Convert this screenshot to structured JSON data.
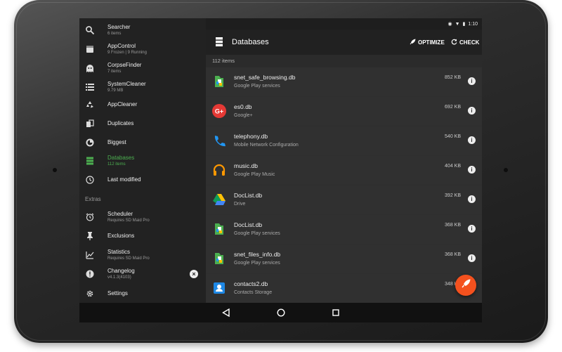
{
  "colors": {
    "accent": "#4caf50",
    "fab": "#f4511e",
    "drawer_bg": "#222222",
    "main_bg": "#303030"
  },
  "status": {
    "time": "1:10"
  },
  "drawer": {
    "items": [
      {
        "label": "Searcher",
        "sub": "6 items",
        "icon": "search-icon"
      },
      {
        "label": "AppControl",
        "sub": "9 Frozen | 9 Running",
        "icon": "app-control-icon"
      },
      {
        "label": "CorpseFinder",
        "sub": "7 items",
        "icon": "ghost-icon"
      },
      {
        "label": "SystemCleaner",
        "sub": "9.79 MB",
        "icon": "list-icon"
      },
      {
        "label": "AppCleaner",
        "sub": "",
        "icon": "recycle-icon"
      },
      {
        "label": "Duplicates",
        "sub": "",
        "icon": "duplicates-icon"
      },
      {
        "label": "Biggest",
        "sub": "",
        "icon": "pie-chart-icon"
      },
      {
        "label": "Databases",
        "sub": "112 items",
        "icon": "database-icon"
      },
      {
        "label": "Last modified",
        "sub": "",
        "icon": "clock-icon"
      }
    ],
    "extras_label": "Extras",
    "extras": [
      {
        "label": "Scheduler",
        "sub": "Requires SD Maid Pro",
        "icon": "alarm-icon"
      },
      {
        "label": "Exclusions",
        "sub": "",
        "icon": "pin-icon"
      },
      {
        "label": "Statistics",
        "sub": "Requires SD Maid Pro",
        "icon": "statistics-icon"
      },
      {
        "label": "Changelog",
        "sub": "v4.1.3(4103)",
        "icon": "changelog-icon"
      },
      {
        "label": "Settings",
        "sub": "",
        "icon": "gear-icon"
      }
    ]
  },
  "toolbar": {
    "title": "Databases",
    "optimize_label": "OPTIMIZE",
    "check_label": "CHECK"
  },
  "list": {
    "count_label": "112 items",
    "rows": [
      {
        "title": "snet_safe_browsing.db",
        "sub": "Google Play services",
        "size": "852 KB",
        "icon": "play-services-icon"
      },
      {
        "title": "es0.db",
        "sub": "Google+",
        "size": "692 KB",
        "icon": "google-plus-icon"
      },
      {
        "title": "telephony.db",
        "sub": "Mobile Network Configuration",
        "size": "540 KB",
        "icon": "phone-icon"
      },
      {
        "title": "music.db",
        "sub": "Google Play Music",
        "size": "404 KB",
        "icon": "headphones-icon"
      },
      {
        "title": "DocList.db",
        "sub": "Drive",
        "size": "392 KB",
        "icon": "drive-icon"
      },
      {
        "title": "DocList.db",
        "sub": "Google Play services",
        "size": "368 KB",
        "icon": "play-services-icon"
      },
      {
        "title": "snet_files_info.db",
        "sub": "Google Play services",
        "size": "368 KB",
        "icon": "play-services-icon"
      },
      {
        "title": "contacts2.db",
        "sub": "Contacts Storage",
        "size": "348 KB",
        "icon": "contacts-icon"
      }
    ]
  }
}
